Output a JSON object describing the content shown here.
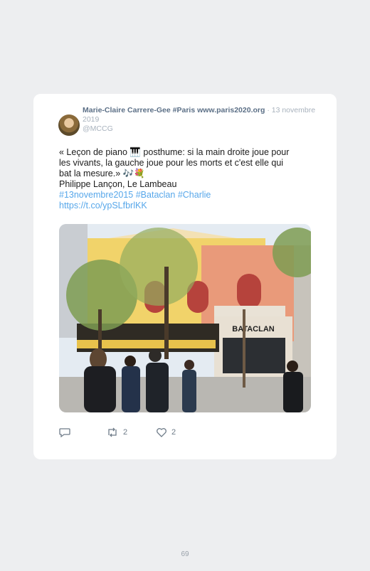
{
  "tweet": {
    "author": "Marie-Claire Carrere-Gee #Paris www.paris2020.org",
    "date": "· 13 novembre 2019",
    "handle": "@MCCG",
    "lines": [
      "« Leçon de piano 🎹 posthume: si la main droite joue pour",
      "les vivants, la gauche joue pour les morts et c'est elle qui",
      "bat la mesure.» 🎶💐",
      "Philippe Lançon, Le Lambeau"
    ],
    "hashtags": [
      "#13novembre2015",
      "#Bataclan",
      "#Charlie"
    ],
    "link": "https://t.co/ypSLfbrlKK",
    "photo_sign": "BATACLAN",
    "retweets": "2",
    "likes": "2"
  },
  "icons": {
    "reply": "reply-icon",
    "retweet": "retweet-icon",
    "like": "heart-icon"
  },
  "page_number": "69"
}
